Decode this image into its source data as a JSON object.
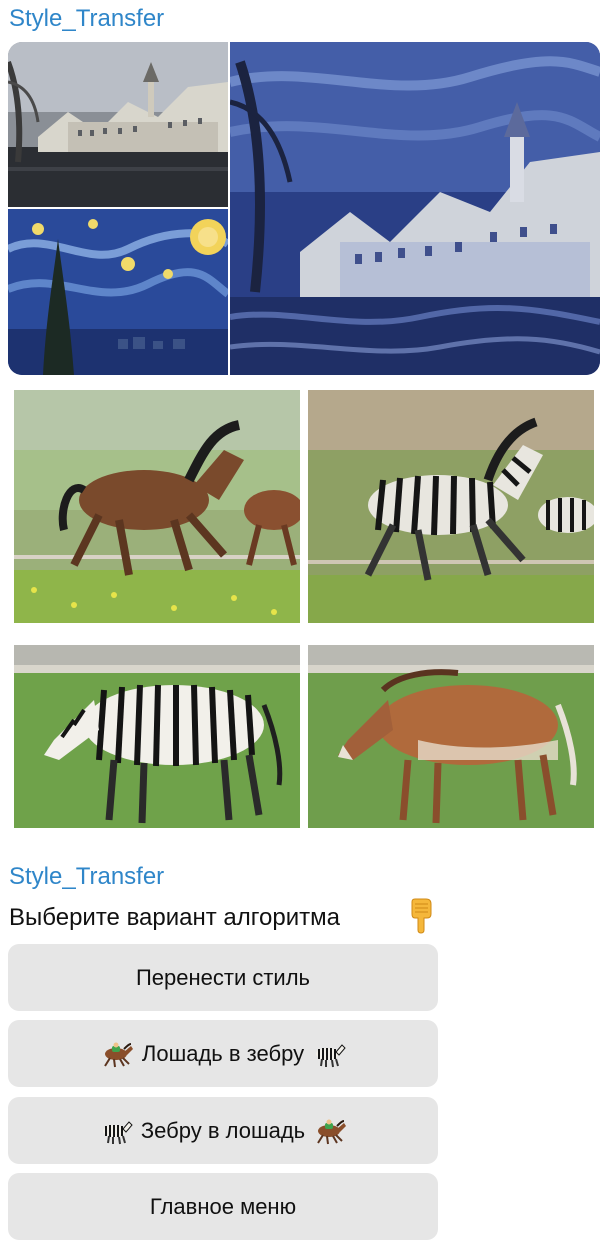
{
  "chat": {
    "sender_name": "Style_Transfer"
  },
  "media": {
    "album_images": [
      {
        "icon": "content-photo-tubingen",
        "subject": "town by river"
      },
      {
        "icon": "style-photo-starry-night",
        "subject": "starry night painting"
      },
      {
        "icon": "result-photo-stylized-town",
        "subject": "stylized town"
      }
    ],
    "grid_images": [
      {
        "icon": "horse-photo",
        "subject": "horses galloping"
      },
      {
        "icon": "zebra-result-photo",
        "subject": "zebras galloping"
      },
      {
        "icon": "zebra-photo",
        "subject": "zebra grazing"
      },
      {
        "icon": "horse-result-photo",
        "subject": "horse grazing"
      }
    ]
  },
  "bot_message": {
    "sender_name": "Style_Transfer",
    "text": "Выберите вариант алгоритма",
    "emoji": "backhand-index-pointing-down-icon"
  },
  "keyboard": {
    "buttons": [
      {
        "label": "Перенести стиль",
        "left_icon": null,
        "right_icon": null
      },
      {
        "label": "Лошадь в зебру",
        "left_icon": "horse-racing-icon",
        "right_icon": "zebra-icon"
      },
      {
        "label": "Зебру в лошадь",
        "left_icon": "zebra-icon",
        "right_icon": "horse-racing-icon"
      },
      {
        "label": "Главное меню",
        "left_icon": null,
        "right_icon": null
      }
    ]
  },
  "colors": {
    "sender": "#2f86c9",
    "button_bg": "#e6e6e6",
    "text": "#111111"
  }
}
